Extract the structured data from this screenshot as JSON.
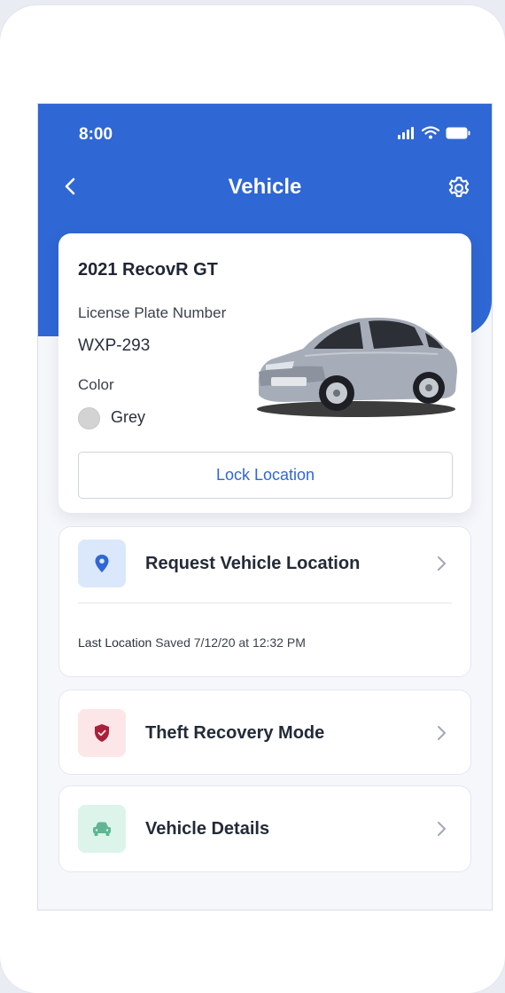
{
  "status_bar": {
    "time": "8:00"
  },
  "nav": {
    "title": "Vehicle"
  },
  "vehicle": {
    "name": "2021 RecovR GT",
    "plate_label": "License Plate Number",
    "plate": "WXP-293",
    "color_label": "Color",
    "color": "Grey",
    "swatch_hex": "#d3d3d3",
    "lock_button_label": "Lock Location"
  },
  "actions": {
    "request_location": {
      "label": "Request Vehicle Location",
      "icon": "location-pin-icon",
      "last_label": "Last Location",
      "last_value": "Saved 7/12/20 at 12:32 PM"
    },
    "theft_recovery": {
      "label": "Theft Recovery Mode",
      "icon": "shield-check-icon"
    },
    "vehicle_details": {
      "label": "Vehicle Details",
      "icon": "car-icon"
    }
  },
  "colors": {
    "brand": "#2f67d4",
    "location_icon_bg": "#dbe7fb",
    "shield_icon_bg": "#fde6e8",
    "shield_icon": "#a8203a",
    "car_icon_bg": "#dcf4ea",
    "car_icon": "#5fb594"
  }
}
